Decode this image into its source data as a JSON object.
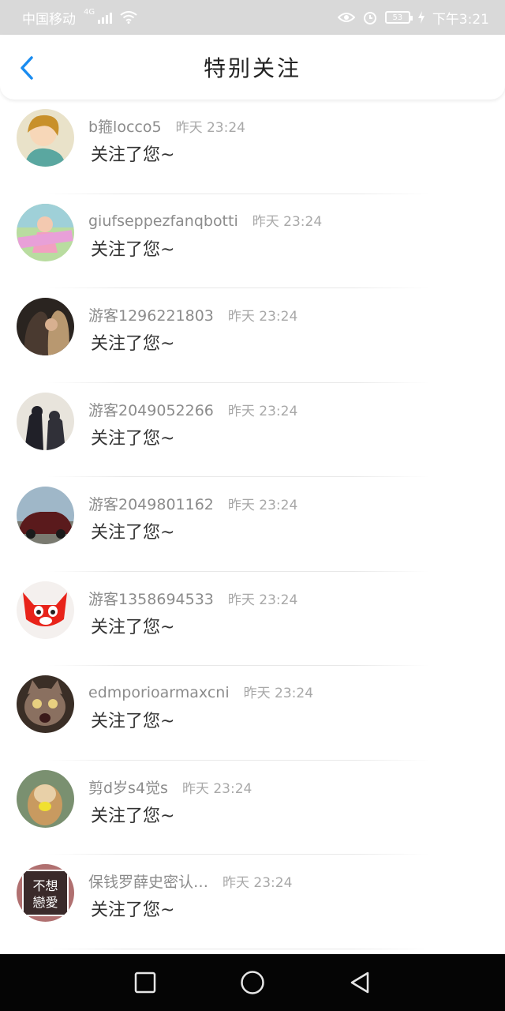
{
  "status_bar": {
    "carrier": "中国移动",
    "network": "4G",
    "battery": "53",
    "time": "下午3:21"
  },
  "header": {
    "title": "特别关注",
    "back_icon": "chevron-left-icon",
    "accent_color": "#1a8cf0"
  },
  "items": [
    {
      "nickname": "b箍locco5",
      "time": "昨天 23:24",
      "message": "关注了您~"
    },
    {
      "nickname": "giufseppezfanqbotti",
      "time": "昨天 23:24",
      "message": "关注了您~"
    },
    {
      "nickname": "游客1296221803",
      "time": "昨天 23:24",
      "message": "关注了您~"
    },
    {
      "nickname": "游客2049052266",
      "time": "昨天 23:24",
      "message": "关注了您~"
    },
    {
      "nickname": "游客2049801162",
      "time": "昨天 23:24",
      "message": "关注了您~"
    },
    {
      "nickname": "游客1358694533",
      "time": "昨天 23:24",
      "message": "关注了您~"
    },
    {
      "nickname": "edmporioarmaxcni",
      "time": "昨天 23:24",
      "message": "关注了您~"
    },
    {
      "nickname": "剪d岁s4觉s",
      "time": "昨天 23:24",
      "message": "关注了您~"
    },
    {
      "nickname": "保钱罗薛史密认…",
      "time": "昨天 23:24",
      "message": "关注了您~",
      "avatar_text": "不想戀愛"
    }
  ],
  "nav_bar": {
    "icons": [
      "square-recent-icon",
      "circle-home-icon",
      "triangle-back-icon"
    ]
  }
}
